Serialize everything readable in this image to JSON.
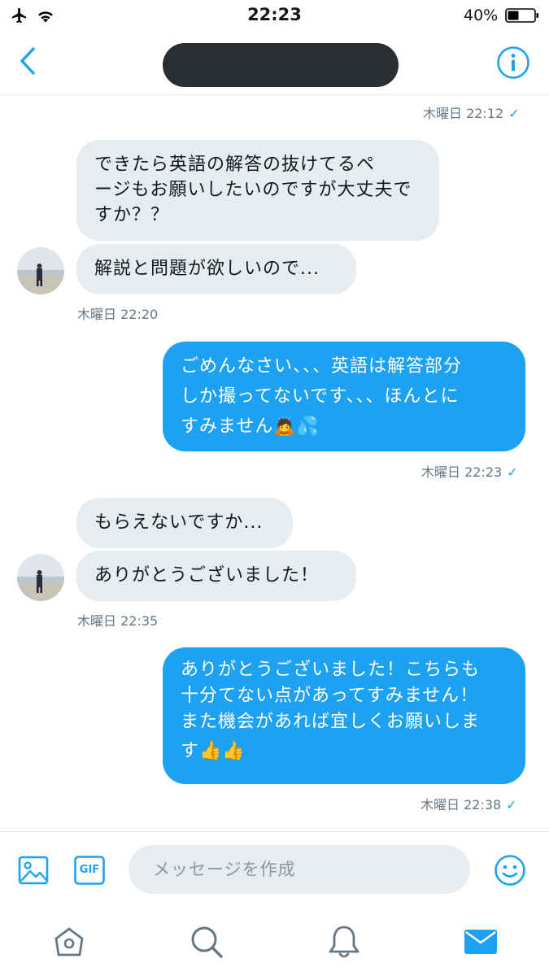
{
  "status_bar": {
    "time": "22:23",
    "battery": "40%"
  },
  "header": {
    "contact_name": "■■■■■"
  },
  "messages": [
    {
      "time": "木曜日 22:12"
    },
    {
      "text": [
        "できたら英語の解答の抜けてるペ",
        "ージもお願いしたいのですが大丈夫で",
        "すか？？"
      ]
    },
    {
      "text": [
        "解説と問題が欲しいので..."
      ]
    },
    {
      "time": "木曜日 22:20"
    },
    {
      "text": [
        "ごめんなさい、、、英語は解答部分",
        "しか撮ってないです、、、ほんとに",
        "すみません🙇💦"
      ]
    },
    {
      "time": "木曜日 22:23"
    },
    {
      "text": [
        "もらえないですか..."
      ]
    },
    {
      "text": [
        "ありがとうございました！"
      ]
    },
    {
      "time": "木曜日 22:35"
    },
    {
      "text": [
        "ありがとうございました！こちらも",
        "十分てない点があってすみません！",
        "また機会があれば宜しくお願いしま",
        "す👍👍"
      ]
    },
    {
      "time": "木曜日 22:38"
    }
  ],
  "composer": {
    "gif_label": "GIF",
    "placeholder": "メッセージを作成"
  },
  "colors": {
    "accent": "#1da1f2",
    "incoming_bubble": "#e6ecf0",
    "muted_text": "#657786"
  },
  "icons": [
    "airplane-icon",
    "wifi-icon",
    "battery-icon",
    "back-icon",
    "info-icon",
    "image-icon",
    "gif-icon",
    "emoji-icon",
    "home-icon",
    "search-icon",
    "notifications-icon",
    "messages-icon"
  ]
}
